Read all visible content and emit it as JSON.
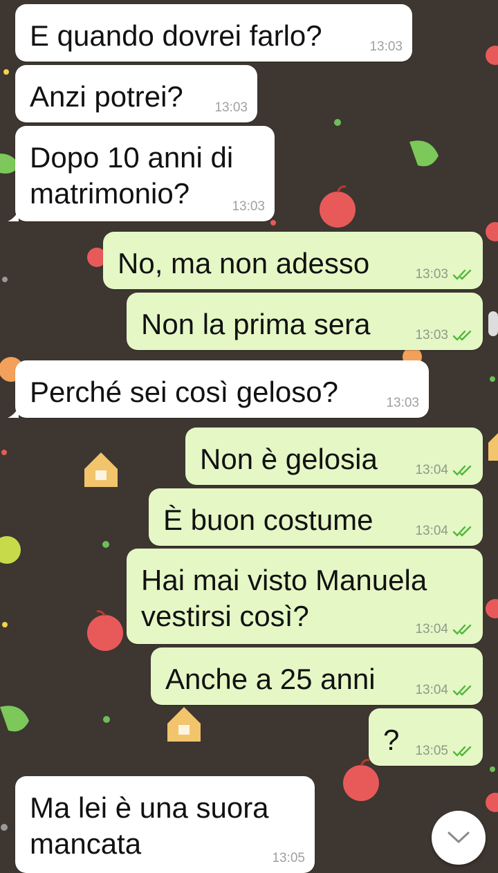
{
  "chat": {
    "messages": [
      {
        "direction": "in",
        "text": "E quando dovrei farlo?",
        "time": "13:03",
        "ticks": false
      },
      {
        "direction": "in",
        "text": "Anzi potrei?",
        "time": "13:03",
        "ticks": false
      },
      {
        "direction": "in",
        "text": "Dopo 10 anni di\nmatrimonio?",
        "time": "13:03",
        "ticks": false
      },
      {
        "direction": "out",
        "text": "No, ma non adesso",
        "time": "13:03",
        "ticks": true
      },
      {
        "direction": "out",
        "text": "Non la prima sera",
        "time": "13:03",
        "ticks": true
      },
      {
        "direction": "in",
        "text": "Perché sei così geloso?",
        "time": "13:03",
        "ticks": false
      },
      {
        "direction": "out",
        "text": "Non è gelosia",
        "time": "13:04",
        "ticks": true
      },
      {
        "direction": "out",
        "text": "È buon costume",
        "time": "13:04",
        "ticks": true
      },
      {
        "direction": "out",
        "text": "Hai mai visto Manuela\nvestirsi così?",
        "time": "13:04",
        "ticks": true
      },
      {
        "direction": "out",
        "text": "Anche a 25 anni",
        "time": "13:04",
        "ticks": true
      },
      {
        "direction": "out",
        "text": "?",
        "time": "13:05",
        "ticks": true
      },
      {
        "direction": "in",
        "text": "Ma lei è una suora\nmancata",
        "time": "13:05",
        "ticks": false
      }
    ]
  },
  "icons": {
    "read_receipt": "double-check-icon",
    "scroll_down": "chevron-down-icon"
  },
  "colors": {
    "wallpaper": "#3d3631",
    "incoming_bubble": "#ffffff",
    "outgoing_bubble": "#e4f7c5",
    "read_tick": "#4fb838"
  }
}
